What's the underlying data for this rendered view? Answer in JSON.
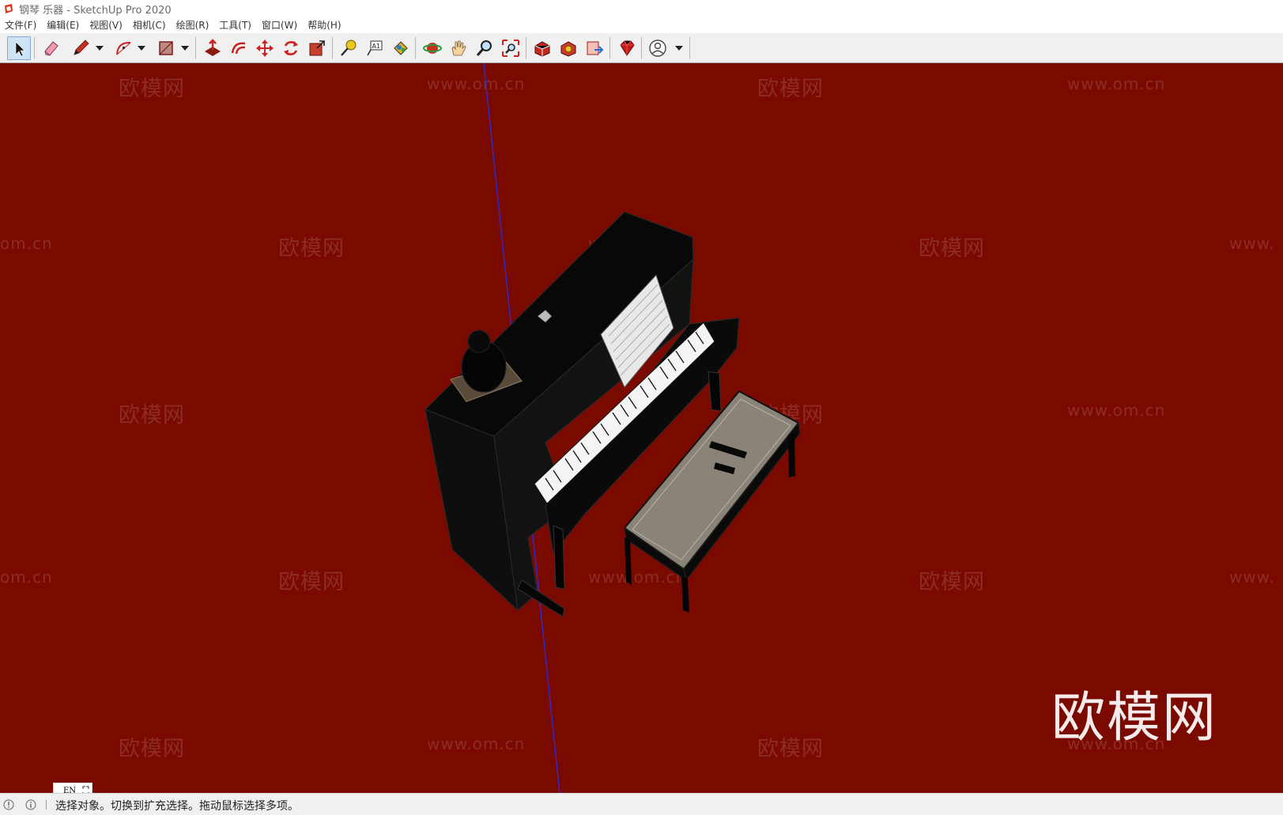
{
  "window": {
    "title": "钢琴 乐器 - SketchUp Pro 2020"
  },
  "menu": [
    "文件(F)",
    "编辑(E)",
    "视图(V)",
    "相机(C)",
    "绘图(R)",
    "工具(T)",
    "窗口(W)",
    "帮助(H)"
  ],
  "toolbar": {
    "tools": [
      {
        "id": "select",
        "icon": "select-arrow-icon",
        "active": true
      },
      {
        "id": "eraser",
        "icon": "eraser-icon"
      },
      {
        "id": "line",
        "icon": "pencil-icon",
        "dropdown": true
      },
      {
        "id": "arc",
        "icon": "arc-icon",
        "dropdown": true
      },
      {
        "id": "shape",
        "icon": "rectangle-icon",
        "dropdown": true
      },
      {
        "id": "push-pull",
        "icon": "push-pull-icon"
      },
      {
        "id": "offset",
        "icon": "offset-icon"
      },
      {
        "id": "move",
        "icon": "move-icon"
      },
      {
        "id": "rotate",
        "icon": "rotate-icon"
      },
      {
        "id": "scale",
        "icon": "scale-icon"
      },
      {
        "id": "tape-measure",
        "icon": "tape-measure-icon"
      },
      {
        "id": "text",
        "icon": "text-icon"
      },
      {
        "id": "paint-bucket",
        "icon": "paint-bucket-icon"
      },
      {
        "id": "orbit",
        "icon": "orbit-icon"
      },
      {
        "id": "pan",
        "icon": "pan-hand-icon"
      },
      {
        "id": "zoom",
        "icon": "zoom-icon"
      },
      {
        "id": "zoom-extents",
        "icon": "zoom-extents-icon"
      },
      {
        "id": "warehouse",
        "icon": "3d-warehouse-icon"
      },
      {
        "id": "extension-warehouse",
        "icon": "extension-warehouse-icon"
      },
      {
        "id": "layout",
        "icon": "send-to-layout-icon"
      },
      {
        "id": "extension-manager",
        "icon": "ruby-icon"
      },
      {
        "id": "account",
        "icon": "user-account-icon",
        "dropdown": true
      }
    ]
  },
  "viewport": {
    "background": "#7a0a00",
    "watermark_text": "欧模网",
    "watermark_url": "www.om.cn",
    "watermark_url_cut": "om.cn",
    "watermark_url_edge": "www.",
    "corner_logo": "欧模网",
    "model": "upright piano with bench"
  },
  "ime": {
    "label": "EN"
  },
  "status": {
    "text": "选择对象。切换到扩充选择。拖动鼠标选择多项。"
  },
  "colors": {
    "select_active": "#cde4f7",
    "toolbar": "#f0f0f0",
    "axis_blue": "#2020c0"
  }
}
